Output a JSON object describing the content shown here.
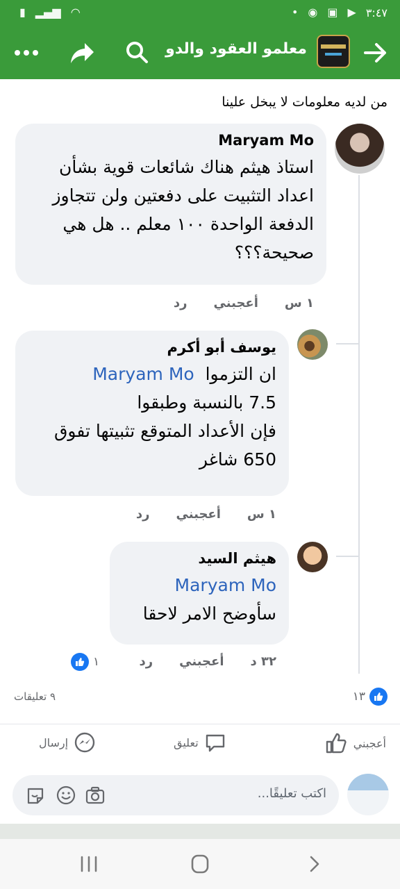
{
  "status": {
    "time": "٣:٤٧"
  },
  "header": {
    "title": "معلمو العقود والدور ...",
    "colors": {
      "green": "#3a9b3a"
    }
  },
  "previous_comment_text": "من لديه معلومات لا يبخل علينا",
  "comments": [
    {
      "author": "Maryam Mo",
      "text": "استاذ هيثم هناك شائعات قوية بشأن اعداد التثبيت على دفعتين ولن تتجاوز الدفعة الواحدة ١٠٠ معلم .. هل هي صحيحة؟؟؟",
      "time": "١ س",
      "like_label": "أعجبني",
      "reply_label": "رد"
    },
    {
      "author": "يوسف أبو أكرم",
      "mention": "Maryam Mo",
      "text": "ان التزموا 7.5 بالنسبة وطبقوا فإن الأعداد المتوقع تثبيتها تفوق 650 شاغر",
      "text_line1": "ان التزموا",
      "text_line2": "7.5 بالنسبة وطبقوا",
      "text_line3": "فإن الأعداد المتوقع تثبيتها تفوق",
      "text_line4": "650 شاغر",
      "time": "١ س",
      "like_label": "أعجبني",
      "reply_label": "رد"
    },
    {
      "author": "هيثم السيد",
      "mention": "Maryam Mo",
      "text": "سأوضح الامر لاحقا",
      "time": "٣٢ د",
      "like_label": "أعجبني",
      "reply_label": "رد",
      "reactions": "١"
    }
  ],
  "post_summary": {
    "likes": "١٣",
    "comments": "٩ تعليقات"
  },
  "actions": {
    "like": "أعجبني",
    "comment": "تعليق",
    "send": "إرسال"
  },
  "compose": {
    "placeholder": "اكتب تعليقًا..."
  }
}
